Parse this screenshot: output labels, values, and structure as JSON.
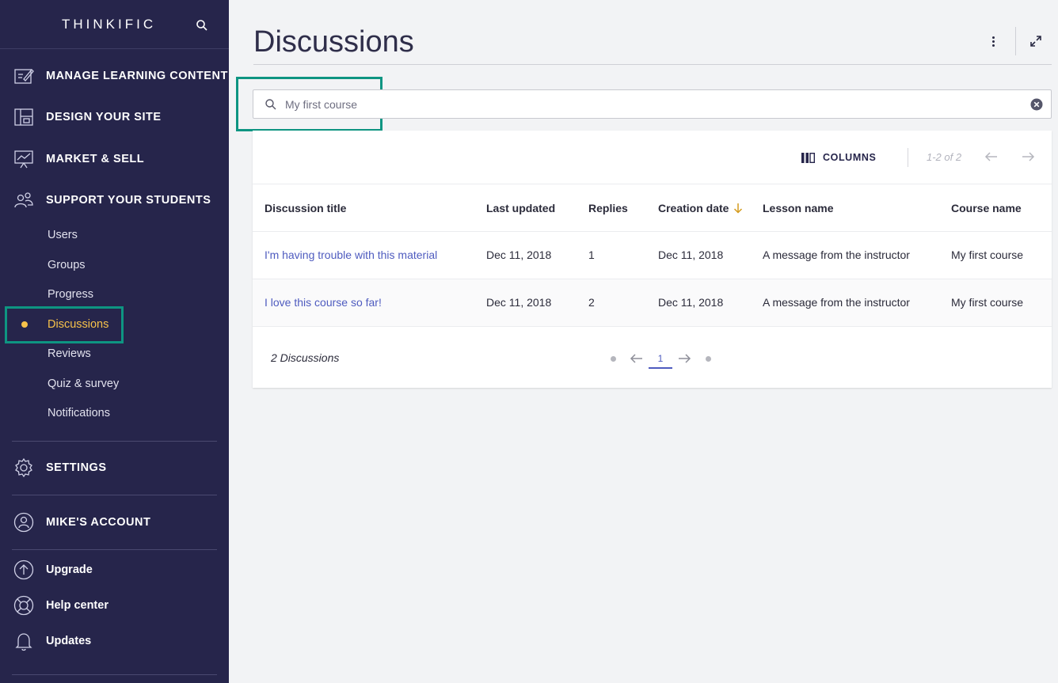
{
  "brand": {
    "name": "THINKIFIC"
  },
  "sidebar": {
    "main": [
      {
        "label": "MANAGE LEARNING CONTENT",
        "icon": "pencil-square-icon"
      },
      {
        "label": "DESIGN YOUR SITE",
        "icon": "layout-icon"
      },
      {
        "label": "MARKET & SELL",
        "icon": "presentation-chart-icon"
      },
      {
        "label": "SUPPORT YOUR STUDENTS",
        "icon": "people-icon"
      }
    ],
    "sub": [
      {
        "label": "Users"
      },
      {
        "label": "Groups"
      },
      {
        "label": "Progress"
      },
      {
        "label": "Discussions",
        "active": true
      },
      {
        "label": "Reviews"
      },
      {
        "label": "Quiz & survey"
      },
      {
        "label": "Notifications"
      }
    ],
    "settings": {
      "label": "SETTINGS",
      "icon": "gear-icon"
    },
    "account": {
      "label": "MIKE'S ACCOUNT",
      "icon": "user-circle-icon"
    },
    "footer": [
      {
        "label": "Upgrade",
        "icon": "arrow-up-circle-icon"
      },
      {
        "label": "Help center",
        "icon": "lifebuoy-icon"
      },
      {
        "label": "Updates",
        "icon": "bell-icon"
      }
    ]
  },
  "page": {
    "title": "Discussions"
  },
  "search": {
    "value": "",
    "placeholder": "My first course"
  },
  "toolbar": {
    "columns_label": "COLUMNS",
    "range": "1-2 of 2"
  },
  "table": {
    "headers": [
      "Discussion title",
      "Last updated",
      "Replies",
      "Creation date",
      "Lesson name",
      "Course name"
    ],
    "sorted_column": "Creation date",
    "sort_direction": "descending",
    "rows": [
      [
        "I'm having trouble with this material",
        "Dec 11, 2018",
        "1",
        "Dec 11, 2018",
        "A message from the instructor",
        "My first course"
      ],
      [
        "I love this course so far!",
        "Dec 11, 2018",
        "2",
        "Dec 11, 2018",
        "A message from the instructor",
        "My first course"
      ]
    ]
  },
  "footer": {
    "count": "2 Discussions",
    "current_page": "1"
  },
  "colors": {
    "sidebar_bg": "#26254b",
    "active": "#f7c24a",
    "link": "#4e5bbf",
    "highlight": "#0e9582",
    "sort_arrow": "#d49a1c"
  }
}
